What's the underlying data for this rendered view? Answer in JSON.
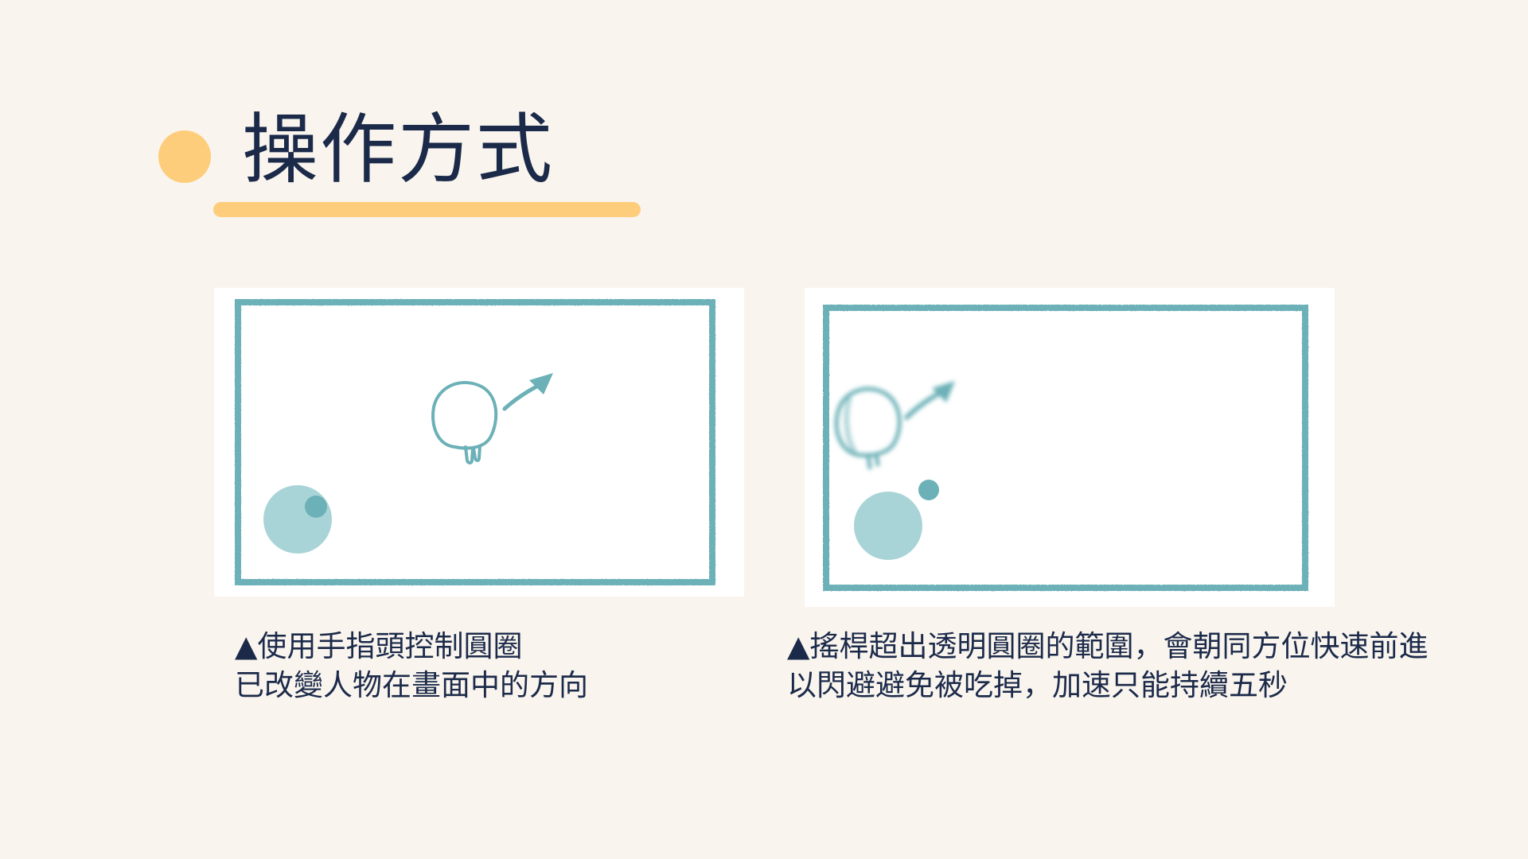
{
  "title": "操作方式",
  "colors": {
    "background": "#f9f5ee",
    "accent_yellow": "#fdcd7b",
    "teal": "#6cb1b7",
    "teal_light": "#a9d4d7",
    "navy_text": "#1c2a4a"
  },
  "illustrations": [
    {
      "name": "finger-joystick-control",
      "caption_lines": [
        "▲使用手指頭控制圓圈",
        "已改變人物在畫面中的方向"
      ]
    },
    {
      "name": "joystick-boost-dash",
      "caption_lines": [
        "▲搖桿超出透明圓圈的範圍，會朝同方位快速前進",
        "以閃避避免被吃掉，加速只能持續五秒"
      ]
    }
  ]
}
